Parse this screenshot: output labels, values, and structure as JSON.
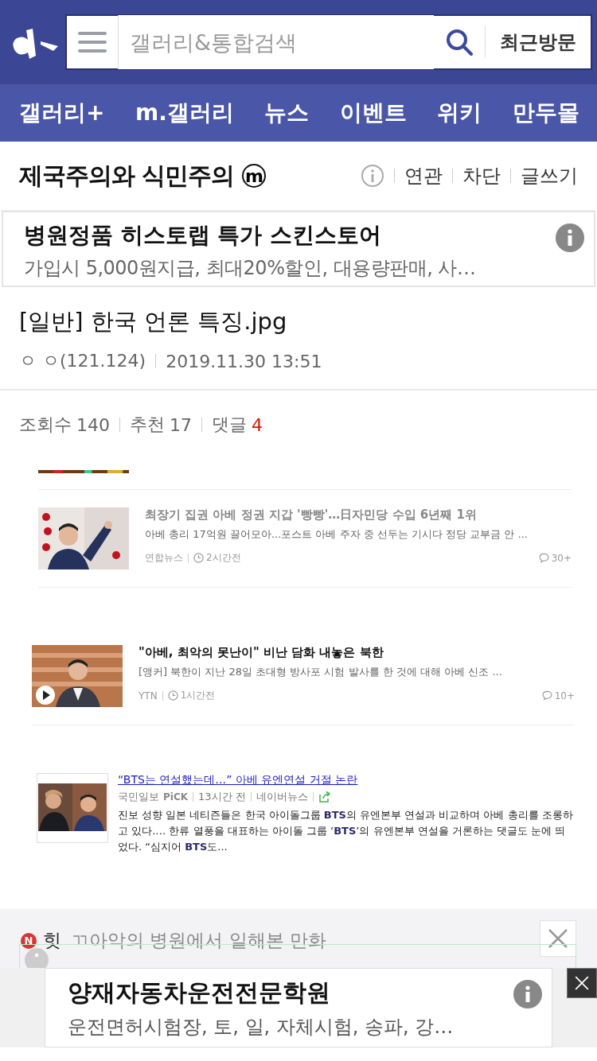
{
  "header": {
    "search_placeholder": "갤러리&통합검색",
    "recent_button": "최근방문"
  },
  "nav": [
    {
      "label": "갤러리+"
    },
    {
      "label": "m.갤러리"
    },
    {
      "label": "뉴스"
    },
    {
      "label": "이벤트"
    },
    {
      "label": "위키"
    },
    {
      "label": "만두몰"
    }
  ],
  "gallery": {
    "title": "제국주의와 식민주의",
    "badge": "m",
    "actions": [
      "연관",
      "차단",
      "글쓰기"
    ]
  },
  "ad_top": {
    "title": "병원정품 히스토랩 특가 스킨스토어",
    "text": "가입시 5,000원지급, 최대20%할인, 대용량판매, 사…"
  },
  "post": {
    "title": "[일반] 한국 언론 특징.jpg",
    "author": "ㅇ ㅇ(121.124)",
    "date": "2019.11.30 13:51"
  },
  "stats": [
    {
      "label": "조회수",
      "value": "140",
      "highlight": false
    },
    {
      "label": "추천",
      "value": "17",
      "highlight": false
    },
    {
      "label": "댓글",
      "value": "4",
      "highlight": true
    }
  ],
  "news": [
    {
      "title": "최장기 집권 아베 정권 지갑 '빵빵'…日자민당 수입 6년째 1위",
      "summary": "아베 총리 17억원 끌어모아...포스트 아베 주자 중 선두는 기시다 정당 교부금 안 ...",
      "source": "연합뉴스",
      "time": "2시간전",
      "comments": "30+"
    },
    {
      "kind": "video",
      "title": "\"아베, 최악의 못난이\" 비난 담화 내놓은 북한",
      "summary": "[앵커] 북한이 지난 28일 초대형 방사포 시험 발사를 한 것에 대해 아베 신조 ...",
      "source": "YTN",
      "time": "1시간전",
      "comments": "10+"
    },
    {
      "kind": "portal",
      "title": "“BTS는 연설했는데…” 아베 유엔연설 거절 논란",
      "source": "국민일보",
      "pick": "PiCK",
      "time": "13시간 전",
      "portal": "네이버뉴스",
      "body": "진보 성향 일본 네티즌들은 한국 아이돌그룹 **BTS**의 유엔본부 연설과 비교하며 아베 총리를 조롱하고 있다.… 한류 열풍을 대표하는 아이돌 그룹 ‘**BTS**’의 유엔본부 연설을 거론하는 댓글도 눈에 띄었다. “심지어 **BTS**도..."
    }
  ],
  "hot": {
    "badge": "N",
    "label": "힛",
    "text": "ㄲ아악의 병원에서 일해본 만화"
  },
  "ad_bottom": {
    "title": "양재자동차운전전문학원",
    "text": "운전면허시험장, 토, 일, 자체시험, 송파, 강…"
  }
}
